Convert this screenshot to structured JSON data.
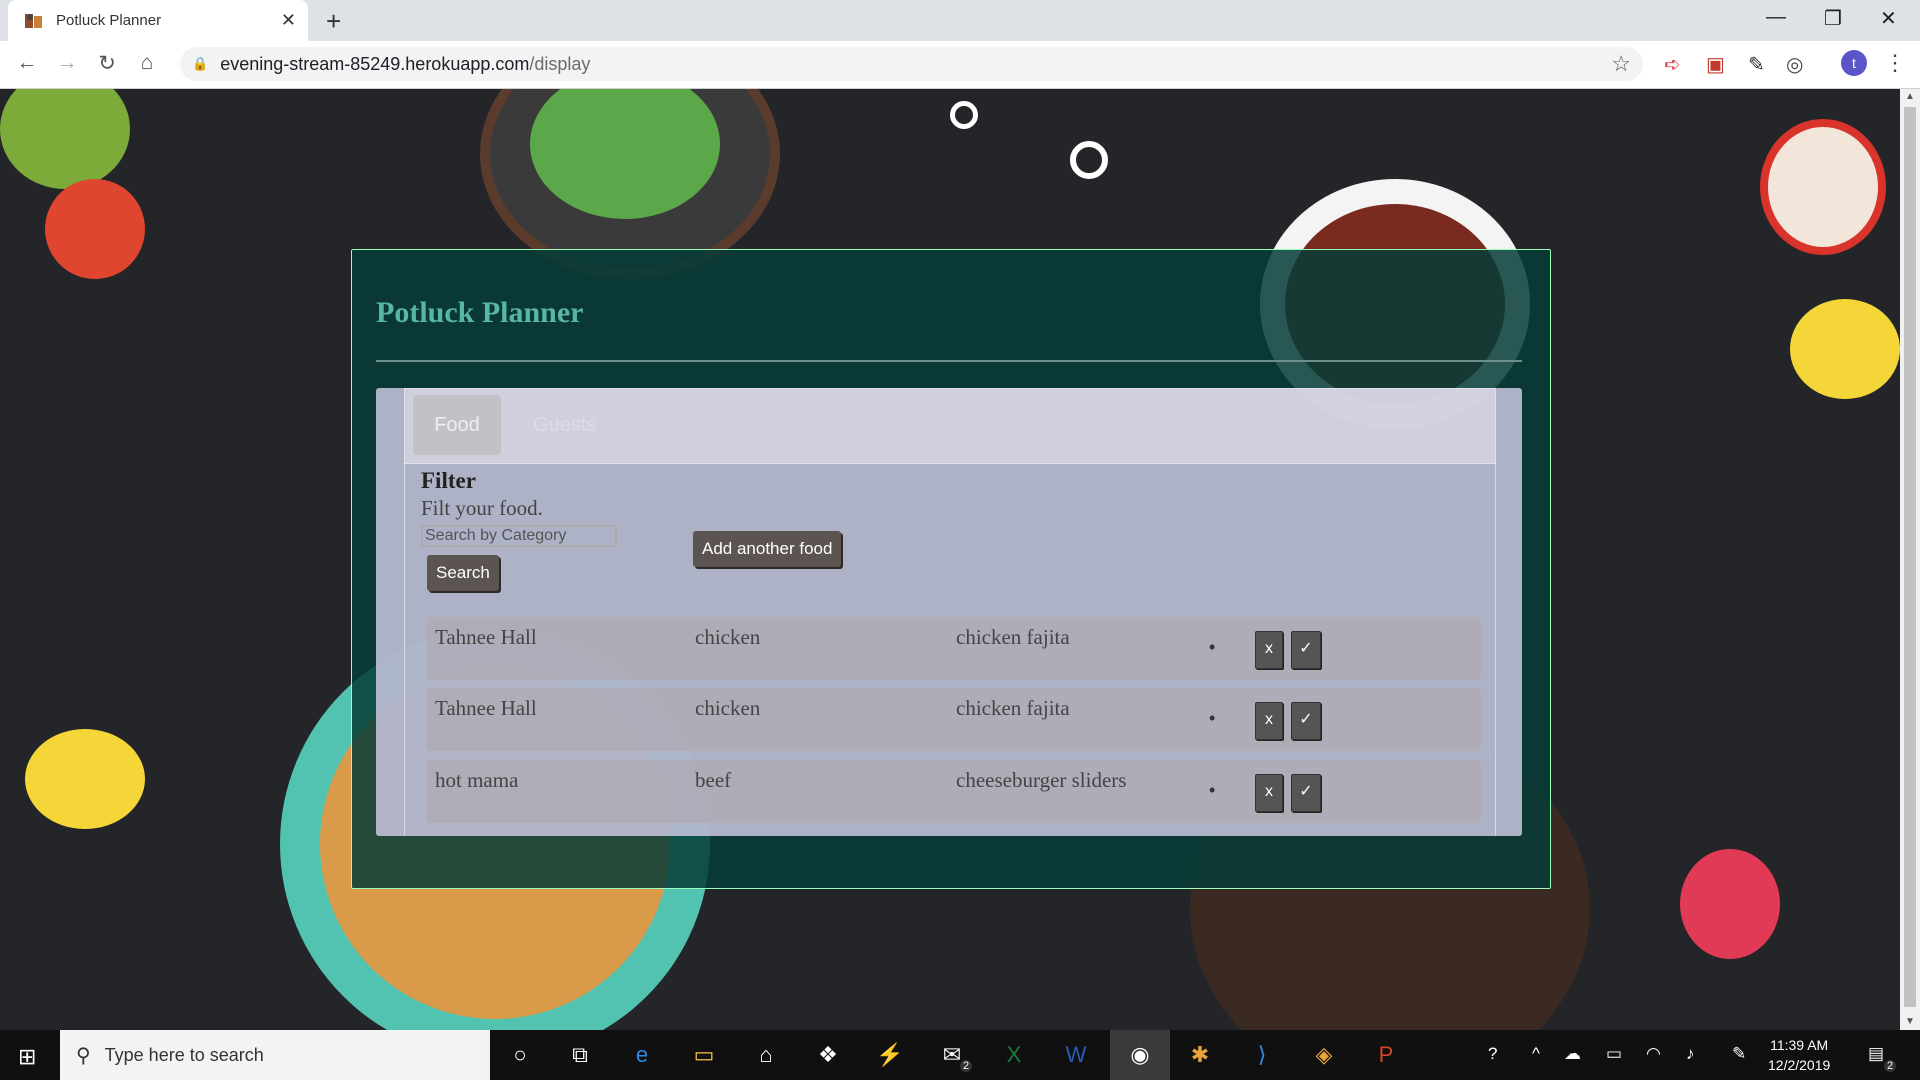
{
  "browser": {
    "tab_title": "Potluck Planner",
    "tab_close": "✕",
    "new_tab": "+",
    "url_host": "evening-stream-85249.herokuapp.com",
    "url_path": "/display",
    "profile_initial": "t",
    "window_controls": {
      "minimize": "—",
      "restore": "❐",
      "close": "✕"
    }
  },
  "app": {
    "title": "Potluck Planner",
    "tabs": [
      {
        "label": "Food"
      },
      {
        "label": "Guests"
      }
    ],
    "filter": {
      "heading": "Filter",
      "subtitle": "Filt your food.",
      "search_placeholder": "Search by Category",
      "search_button": "Search"
    },
    "add_button": "Add another food",
    "rows": [
      {
        "name": "Tahnee Hall",
        "category": "chicken",
        "dish": "chicken fajita",
        "delete": "x",
        "confirm": "✓"
      },
      {
        "name": "Tahnee Hall",
        "category": "chicken",
        "dish": "chicken fajita",
        "delete": "x",
        "confirm": "✓"
      },
      {
        "name": "hot mama",
        "category": "beef",
        "dish": "cheeseburger sliders",
        "delete": "x",
        "confirm": "✓"
      }
    ]
  },
  "taskbar": {
    "search_placeholder": "Type here to search",
    "time": "11:39 AM",
    "date": "12/2/2019",
    "mail_badge": "2",
    "notification_badge": "2"
  },
  "colors": {
    "card_bg": "#053c37",
    "title": "#58b6a6",
    "button": "#5b5451"
  }
}
